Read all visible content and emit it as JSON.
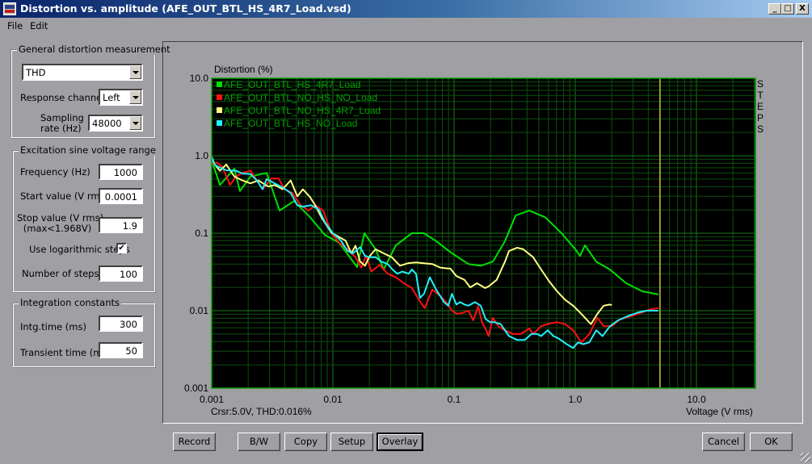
{
  "window": {
    "title": "Distortion vs. amplitude (AFE_OUT_BTL_HS_4R7_Load.vsd)",
    "minimize_label": "_",
    "maximize_label": "□",
    "close_label": "X"
  },
  "menu": [
    "File",
    "Edit"
  ],
  "general": {
    "title": "General distortion measurement",
    "measurement_type": "THD",
    "response_channel_label": "Response channel",
    "response_channel": "Left",
    "sampling_label_1": "Sampling",
    "sampling_label_2": "rate (Hz)",
    "sampling_rate": "48000"
  },
  "excitation": {
    "title": "Excitation sine voltage range",
    "frequency_label": "Frequency (Hz)",
    "frequency": "1000",
    "start_label": "Start value (V rms)",
    "start": "0.0001",
    "stop_label_1": "Stop value (V rms)",
    "stop_label_2": "(max<1.968V)",
    "stop": "1.9",
    "log_steps_label": "Use logarithmic steps",
    "log_steps_checked": true,
    "log_steps_mark": "✔",
    "steps_label": "Number of steps",
    "steps": "100"
  },
  "integration": {
    "title": "Integration constants",
    "intg_label": "Intg.time (ms)",
    "intg": "300",
    "transient_label": "Transient time (ms)",
    "transient": "50"
  },
  "plot": {
    "side_label": [
      "S",
      "T",
      "E",
      "P",
      "S"
    ],
    "cursor_readout": "Crsr:5.0V, THD:0.016%"
  },
  "buttons": {
    "record": "Record",
    "bw": "B/W",
    "copy": "Copy",
    "setup": "Setup",
    "overlay": "Overlay",
    "cancel": "Cancel",
    "ok": "OK"
  },
  "chart_data": {
    "type": "line",
    "title": "",
    "xlabel": "Voltage (V rms)",
    "ylabel": "Distortion (%)",
    "xscale": "log",
    "yscale": "log",
    "xlim": [
      0.001,
      30
    ],
    "ylim": [
      0.001,
      10
    ],
    "x_ticks": [
      {
        "v": 0.001,
        "label": "0.001"
      },
      {
        "v": 0.01,
        "label": "0.01"
      },
      {
        "v": 0.1,
        "label": "0.1"
      },
      {
        "v": 1,
        "label": "1.0"
      },
      {
        "v": 10,
        "label": "10.0"
      }
    ],
    "y_ticks": [
      {
        "v": 10,
        "label": "10.0"
      },
      {
        "v": 1,
        "label": "1.0"
      },
      {
        "v": 0.1,
        "label": "0.1"
      },
      {
        "v": 0.01,
        "label": "0.01"
      },
      {
        "v": 0.001,
        "label": "0.001"
      }
    ],
    "grid": true,
    "background": "#000000",
    "grid_color": "#0f4d0f",
    "frame_color": "#00a000",
    "cursor": {
      "x": 5.0,
      "color": "#c8c040"
    },
    "legend_position": "top-left",
    "series": [
      {
        "name": "AFE_OUT_BTL_HS_4R7_Load",
        "color": "#00e000",
        "points": [
          [
            0.001,
            0.87
          ],
          [
            0.00117,
            0.42
          ],
          [
            0.00154,
            0.68
          ],
          [
            0.00171,
            0.35
          ],
          [
            0.00209,
            0.54
          ],
          [
            0.00284,
            0.6
          ],
          [
            0.00363,
            0.196
          ],
          [
            0.00478,
            0.26
          ],
          [
            0.00651,
            0.16
          ],
          [
            0.00858,
            0.095
          ],
          [
            0.01129,
            0.075
          ],
          [
            0.01585,
            0.0365
          ],
          [
            0.0182,
            0.1
          ],
          [
            0.02254,
            0.062
          ],
          [
            0.02623,
            0.034
          ],
          [
            0.03311,
            0.07
          ],
          [
            0.04487,
            0.1
          ],
          [
            0.05646,
            0.1
          ],
          [
            0.07111,
            0.079
          ],
          [
            0.09611,
            0.055
          ],
          [
            0.1314,
            0.04
          ],
          [
            0.166,
            0.038
          ],
          [
            0.2089,
            0.043
          ],
          [
            0.263,
            0.079
          ],
          [
            0.3221,
            0.17
          ],
          [
            0.4178,
            0.196
          ],
          [
            0.5675,
            0.16
          ],
          [
            0.7709,
            0.1
          ],
          [
            1.0,
            0.062
          ],
          [
            1.096,
            0.051
          ],
          [
            1.202,
            0.07
          ],
          [
            1.489,
            0.043
          ],
          [
            1.933,
            0.034
          ],
          [
            2.63,
            0.0226
          ],
          [
            3.573,
            0.0178
          ],
          [
            4.853,
            0.0162
          ]
        ]
      },
      {
        "name": "AFE_OUT_BTL_NO_HS_NO_Load",
        "color": "#ff1010",
        "points": [
          [
            0.001,
            0.77
          ],
          [
            0.0011,
            0.82
          ],
          [
            0.00122,
            0.72
          ],
          [
            0.00142,
            0.42
          ],
          [
            0.00159,
            0.54
          ],
          [
            0.00179,
            0.6
          ],
          [
            0.00209,
            0.64
          ],
          [
            0.00236,
            0.48
          ],
          [
            0.00263,
            0.37
          ],
          [
            0.00311,
            0.51
          ],
          [
            0.00357,
            0.51
          ],
          [
            0.00398,
            0.37
          ],
          [
            0.00464,
            0.33
          ],
          [
            0.00541,
            0.23
          ],
          [
            0.00631,
            0.196
          ],
          [
            0.00714,
            0.23
          ],
          [
            0.00832,
            0.196
          ],
          [
            0.00972,
            0.1
          ],
          [
            0.01129,
            0.075
          ],
          [
            0.01318,
            0.062
          ],
          [
            0.01538,
            0.049
          ],
          [
            0.01711,
            0.036
          ],
          [
            0.01877,
            0.051
          ],
          [
            0.02081,
            0.032
          ],
          [
            0.02427,
            0.039
          ],
          [
            0.02831,
            0.03
          ],
          [
            0.03311,
            0.027
          ],
          [
            0.03853,
            0.0226
          ],
          [
            0.04487,
            0.0196
          ],
          [
            0.05233,
            0.0131
          ],
          [
            0.05727,
            0.0108
          ],
          [
            0.06619,
            0.0187
          ],
          [
            0.07674,
            0.0155
          ],
          [
            0.08952,
            0.012
          ],
          [
            0.09611,
            0.01
          ],
          [
            0.1054,
            0.0091
          ],
          [
            0.1164,
            0.0093
          ],
          [
            0.1314,
            0.01
          ],
          [
            0.1441,
            0.0075
          ],
          [
            0.1581,
            0.0114
          ],
          [
            0.1698,
            0.0071
          ],
          [
            0.1842,
            0.0056
          ],
          [
            0.1928,
            0.0047
          ],
          [
            0.2089,
            0.0081
          ],
          [
            0.2341,
            0.0062
          ],
          [
            0.263,
            0.0056
          ],
          [
            0.3055,
            0.005
          ],
          [
            0.3548,
            0.005
          ],
          [
            0.4178,
            0.0059
          ],
          [
            0.4487,
            0.005
          ],
          [
            0.5233,
            0.0063
          ],
          [
            0.6081,
            0.0068
          ],
          [
            0.7079,
            0.0071
          ],
          [
            0.8254,
            0.0067
          ],
          [
            0.9611,
            0.0056
          ],
          [
            1.122,
            0.0039
          ],
          [
            1.3065,
            0.005
          ],
          [
            1.5234,
            0.0081
          ],
          [
            1.7179,
            0.0063
          ],
          [
            2.0,
            0.0063
          ],
          [
            2.3335,
            0.0077
          ],
          [
            2.8183,
            0.0084
          ],
          [
            3.5727,
            0.0095
          ],
          [
            4.1687,
            0.0104
          ],
          [
            4.8529,
            0.0108
          ]
        ]
      },
      {
        "name": "AFE_OUT_BTL_NO_HS_4R7_Load",
        "color": "#ffff80",
        "points": [
          [
            0.001,
            0.95
          ],
          [
            0.00106,
            0.77
          ],
          [
            0.00117,
            0.64
          ],
          [
            0.00132,
            0.77
          ],
          [
            0.00154,
            0.54
          ],
          [
            0.00179,
            0.48
          ],
          [
            0.00209,
            0.44
          ],
          [
            0.00243,
            0.48
          ],
          [
            0.00293,
            0.4
          ],
          [
            0.00331,
            0.42
          ],
          [
            0.00385,
            0.37
          ],
          [
            0.00449,
            0.48
          ],
          [
            0.00509,
            0.3
          ],
          [
            0.00566,
            0.37
          ],
          [
            0.00651,
            0.29
          ],
          [
            0.00714,
            0.23
          ],
          [
            0.00805,
            0.16
          ],
          [
            0.00972,
            0.102
          ],
          [
            0.01129,
            0.089
          ],
          [
            0.01274,
            0.08
          ],
          [
            0.01419,
            0.055
          ],
          [
            0.01538,
            0.069
          ],
          [
            0.0168,
            0.043
          ],
          [
            0.0184,
            0.038
          ],
          [
            0.0202,
            0.051
          ],
          [
            0.02254,
            0.062
          ],
          [
            0.02623,
            0.055
          ],
          [
            0.03055,
            0.049
          ],
          [
            0.03573,
            0.038
          ],
          [
            0.04168,
            0.041
          ],
          [
            0.04853,
            0.042
          ],
          [
            0.05646,
            0.041
          ],
          [
            0.06619,
            0.04
          ],
          [
            0.07674,
            0.036
          ],
          [
            0.08952,
            0.035
          ],
          [
            0.0931,
            0.035
          ],
          [
            0.1045,
            0.028
          ],
          [
            0.1219,
            0.025
          ],
          [
            0.1359,
            0.02
          ],
          [
            0.1543,
            0.0226
          ],
          [
            0.1799,
            0.0196
          ],
          [
            0.1928,
            0.0206
          ],
          [
            0.2244,
            0.025
          ],
          [
            0.263,
            0.043
          ],
          [
            0.2838,
            0.059
          ],
          [
            0.3311,
            0.065
          ],
          [
            0.3722,
            0.062
          ],
          [
            0.4487,
            0.049
          ],
          [
            0.5233,
            0.034
          ],
          [
            0.6081,
            0.024
          ],
          [
            0.7079,
            0.0178
          ],
          [
            0.8254,
            0.0138
          ],
          [
            0.9611,
            0.0116
          ],
          [
            1.122,
            0.0091
          ],
          [
            1.3459,
            0.0067
          ],
          [
            1.5234,
            0.0091
          ],
          [
            1.7179,
            0.0116
          ],
          [
            1.9326,
            0.012
          ],
          [
            2.0,
            0.0118
          ]
        ]
      },
      {
        "name": "AFE_OUT_BTL_HS_NO_Load",
        "color": "#20f0ff",
        "points": [
          [
            0.001,
            0.98
          ],
          [
            0.00106,
            0.77
          ],
          [
            0.00113,
            0.72
          ],
          [
            0.00132,
            0.65
          ],
          [
            0.00159,
            0.64
          ],
          [
            0.00179,
            0.59
          ],
          [
            0.00209,
            0.58
          ],
          [
            0.00236,
            0.48
          ],
          [
            0.00263,
            0.37
          ],
          [
            0.00284,
            0.5
          ],
          [
            0.00331,
            0.44
          ],
          [
            0.00385,
            0.39
          ],
          [
            0.00449,
            0.33
          ],
          [
            0.00509,
            0.23
          ],
          [
            0.00566,
            0.22
          ],
          [
            0.00664,
            0.23
          ],
          [
            0.00771,
            0.2
          ],
          [
            0.00858,
            0.14
          ],
          [
            0.01,
            0.1
          ],
          [
            0.01166,
            0.08
          ],
          [
            0.01318,
            0.059
          ],
          [
            0.01468,
            0.055
          ],
          [
            0.0168,
            0.066
          ],
          [
            0.0184,
            0.051
          ],
          [
            0.0202,
            0.049
          ],
          [
            0.02254,
            0.049
          ],
          [
            0.02512,
            0.043
          ],
          [
            0.02831,
            0.04
          ],
          [
            0.03104,
            0.034
          ],
          [
            0.03406,
            0.03
          ],
          [
            0.03733,
            0.032
          ],
          [
            0.04227,
            0.03
          ],
          [
            0.04487,
            0.034
          ],
          [
            0.04853,
            0.03
          ],
          [
            0.05233,
            0.0146
          ],
          [
            0.05646,
            0.0165
          ],
          [
            0.0631,
            0.027
          ],
          [
            0.07111,
            0.0187
          ],
          [
            0.07674,
            0.0155
          ],
          [
            0.08252,
            0.0129
          ],
          [
            0.08952,
            0.0116
          ],
          [
            0.09611,
            0.0165
          ],
          [
            0.1045,
            0.012
          ],
          [
            0.1124,
            0.0129
          ],
          [
            0.1219,
            0.012
          ],
          [
            0.1314,
            0.0116
          ],
          [
            0.1489,
            0.0129
          ],
          [
            0.166,
            0.0116
          ],
          [
            0.182,
            0.0078
          ],
          [
            0.1991,
            0.0071
          ],
          [
            0.2153,
            0.0071
          ],
          [
            0.2424,
            0.0067
          ],
          [
            0.2838,
            0.0047
          ],
          [
            0.3311,
            0.0042
          ],
          [
            0.3837,
            0.0042
          ],
          [
            0.4345,
            0.005
          ],
          [
            0.4853,
            0.005
          ],
          [
            0.5233,
            0.0047
          ],
          [
            0.5927,
            0.0056
          ],
          [
            0.6606,
            0.0047
          ],
          [
            0.7244,
            0.0044
          ],
          [
            0.8483,
            0.0037
          ],
          [
            0.9611,
            0.0033
          ],
          [
            1.0539,
            0.0039
          ],
          [
            1.1599,
            0.0037
          ],
          [
            1.3065,
            0.0039
          ],
          [
            1.4895,
            0.0056
          ],
          [
            1.6788,
            0.0047
          ],
          [
            1.9326,
            0.0063
          ],
          [
            2.249,
            0.0075
          ],
          [
            2.7535,
            0.0086
          ],
          [
            3.3113,
            0.0095
          ],
          [
            3.8459,
            0.01
          ],
          [
            4.8529,
            0.01
          ]
        ]
      }
    ]
  }
}
